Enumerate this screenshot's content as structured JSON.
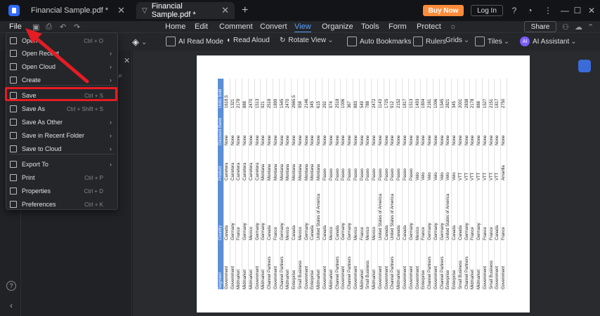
{
  "tabs": [
    {
      "label": "Financial Sample.pdf *"
    },
    {
      "label": "Financial Sample.pdf *"
    }
  ],
  "titlebar": {
    "buy_now": "Buy Now",
    "login": "Log In"
  },
  "menubar": {
    "file": "File",
    "items": [
      "Home",
      "Edit",
      "Comment",
      "Convert",
      "View",
      "Organize",
      "Tools",
      "Form",
      "Protect"
    ],
    "active": "View",
    "share": "Share"
  },
  "toolbar": {
    "ai_read_mode": "AI Read Mode",
    "read_aloud": "Read Aloud",
    "rotate_view": "Rotate View",
    "auto_bookmarks": "Auto Bookmarks",
    "rulers": "Rulers",
    "grids": "Grids",
    "tiles": "Tiles",
    "ai_assistant": "AI Assistant",
    "ai_badge": "AI"
  },
  "file_menu": {
    "items": [
      {
        "label": "Open",
        "shortcut": "Ctrl + O",
        "arrow": false
      },
      {
        "label": "Open Recent",
        "shortcut": "",
        "arrow": true
      },
      {
        "label": "Open Cloud",
        "shortcut": "",
        "arrow": true
      },
      {
        "label": "Create",
        "shortcut": "",
        "arrow": true
      },
      {
        "label": "Save",
        "shortcut": "Ctrl + S",
        "arrow": false
      },
      {
        "label": "Save As",
        "shortcut": "Ctrl + Shift + S",
        "arrow": false
      },
      {
        "label": "Save As Other",
        "shortcut": "",
        "arrow": true
      },
      {
        "label": "Save in Recent Folder",
        "shortcut": "",
        "arrow": true
      },
      {
        "label": "Save to Cloud",
        "shortcut": "",
        "arrow": true
      },
      {
        "label": "Export To",
        "shortcut": "",
        "arrow": true
      },
      {
        "label": "Print",
        "shortcut": "Ctrl + P",
        "arrow": false
      },
      {
        "label": "Properties",
        "shortcut": "Ctrl + D",
        "arrow": false
      },
      {
        "label": "Preferences",
        "shortcut": "Ctrl + K",
        "arrow": false
      }
    ]
  },
  "document": {
    "headers": [
      "Segment",
      "Country",
      "Product",
      "Discount Band",
      "Units Sold"
    ],
    "rows": [
      [
        "Government",
        "Canada",
        "Carretera",
        "None",
        "1618.5"
      ],
      [
        "Government",
        "Germany",
        "Carretera",
        "None",
        "1321"
      ],
      [
        "Midmarket",
        "France",
        "Carretera",
        "None",
        "2178"
      ],
      [
        "Midmarket",
        "Germany",
        "Carretera",
        "None",
        "888"
      ],
      [
        "Midmarket",
        "Mexico",
        "Carretera",
        "None",
        "2470"
      ],
      [
        "Government",
        "Germany",
        "Carretera",
        "None",
        "1513"
      ],
      [
        "Midmarket",
        "Germany",
        "Montana",
        "None",
        "921"
      ],
      [
        "Channel Partners",
        "Canada",
        "Montana",
        "None",
        "2518"
      ],
      [
        "Government",
        "France",
        "Montana",
        "None",
        "1899"
      ],
      [
        "Channel Partners",
        "Germany",
        "Montana",
        "None",
        "1545"
      ],
      [
        "Midmarket",
        "Mexico",
        "Montana",
        "None",
        "2470"
      ],
      [
        "Enterprise",
        "Canada",
        "Montana",
        "None",
        "2665.5"
      ],
      [
        "Small Business",
        "Mexico",
        "Montana",
        "None",
        "958"
      ],
      [
        "Government",
        "Germany",
        "Montana",
        "None",
        "2146"
      ],
      [
        "Enterprise",
        "Canada",
        "Montana",
        "None",
        "345"
      ],
      [
        "Midmarket",
        "United States of America",
        "Montana",
        "None",
        "615"
      ],
      [
        "Government",
        "Canada",
        "Paseo",
        "None",
        "292"
      ],
      [
        "Midmarket",
        "Mexico",
        "Paseo",
        "None",
        "974"
      ],
      [
        "Channel Partners",
        "Canada",
        "Paseo",
        "None",
        "2518"
      ],
      [
        "Government",
        "Germany",
        "Paseo",
        "None",
        "1006"
      ],
      [
        "Channel Partners",
        "Germany",
        "Paseo",
        "None",
        "367"
      ],
      [
        "Government",
        "Mexico",
        "Paseo",
        "None",
        "883"
      ],
      [
        "Midmarket",
        "France",
        "Paseo",
        "None",
        "549"
      ],
      [
        "Small Business",
        "Mexico",
        "Paseo",
        "None",
        "788"
      ],
      [
        "Midmarket",
        "Mexico",
        "Paseo",
        "None",
        "2472"
      ],
      [
        "Government",
        "United States of America",
        "Paseo",
        "None",
        "1143"
      ],
      [
        "Government",
        "Canada",
        "Paseo",
        "None",
        "1725"
      ],
      [
        "Channel Partners",
        "United States of America",
        "Paseo",
        "None",
        "912"
      ],
      [
        "Midmarket",
        "Canada",
        "Paseo",
        "None",
        "2152"
      ],
      [
        "Government",
        "Canada",
        "Paseo",
        "None",
        "1817"
      ],
      [
        "Government",
        "Germany",
        "Paseo",
        "None",
        "1513"
      ],
      [
        "Government",
        "Mexico",
        "Velo",
        "None",
        "1493"
      ],
      [
        "Enterprise",
        "France",
        "Velo",
        "None",
        "1804"
      ],
      [
        "Channel Partners",
        "Germany",
        "Velo",
        "None",
        "2161"
      ],
      [
        "Government",
        "Germany",
        "Velo",
        "None",
        "1006"
      ],
      [
        "Channel Partners",
        "Germany",
        "Velo",
        "None",
        "1545"
      ],
      [
        "Enterprise",
        "United States of America",
        "Velo",
        "None",
        "2821"
      ],
      [
        "Enterprise",
        "Canada",
        "Velo",
        "None",
        "345"
      ],
      [
        "Small Business",
        "Canada",
        "VTT",
        "None",
        "2001"
      ],
      [
        "Channel Partners",
        "Germany",
        "VTT",
        "None",
        "2838"
      ],
      [
        "Midmarket",
        "France",
        "VTT",
        "None",
        "2178"
      ],
      [
        "Midmarket",
        "Germany",
        "VTT",
        "None",
        "888"
      ],
      [
        "Government",
        "France",
        "VTT",
        "None",
        "1527"
      ],
      [
        "Small Business",
        "France",
        "VTT",
        "None",
        "2151"
      ],
      [
        "Government",
        "Canada",
        "VTT",
        "None",
        "1817"
      ],
      [
        "Government",
        "France",
        "Amarilla",
        "None",
        "2750"
      ]
    ]
  },
  "colors": {
    "accent": "#5aa0ff",
    "highlight": "#e51c23",
    "buy_now": "#ff8c3a",
    "table_header": "#5b8fd6"
  }
}
